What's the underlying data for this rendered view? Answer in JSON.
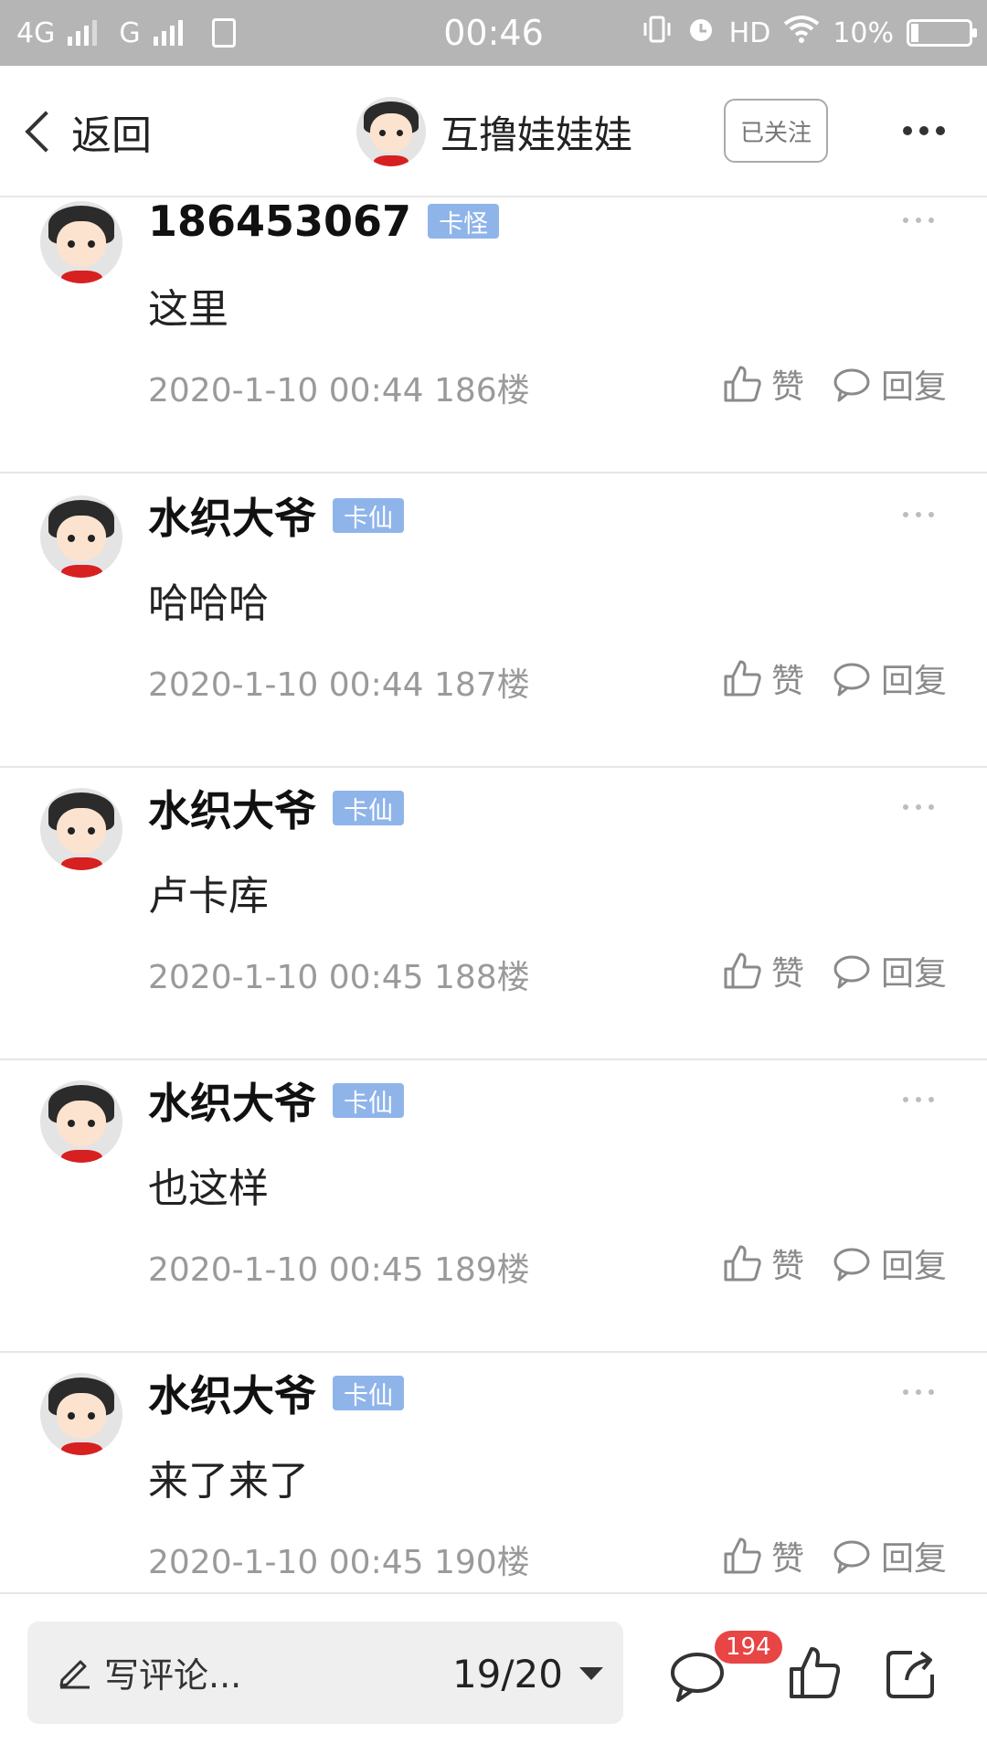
{
  "status_bar": {
    "network1": "4G",
    "network2": "G",
    "time": "00:46",
    "hd": "HD",
    "battery": "10%"
  },
  "nav": {
    "back_label": "返回",
    "user_name": "互撸娃娃娃",
    "follow_label": "已关注"
  },
  "comments": [
    {
      "name": "186453067",
      "badge": "卡怪",
      "text": "这里",
      "meta": "2020-1-10 00:44  186楼",
      "like_label": "赞",
      "reply_label": "回复"
    },
    {
      "name": "水织大爷",
      "badge": "卡仙",
      "text": "哈哈哈",
      "meta": "2020-1-10 00:44  187楼",
      "like_label": "赞",
      "reply_label": "回复"
    },
    {
      "name": "水织大爷",
      "badge": "卡仙",
      "text": "卢卡库",
      "meta": "2020-1-10 00:45  188楼",
      "like_label": "赞",
      "reply_label": "回复"
    },
    {
      "name": "水织大爷",
      "badge": "卡仙",
      "text": "也这样",
      "meta": "2020-1-10 00:45  189楼",
      "like_label": "赞",
      "reply_label": "回复"
    },
    {
      "name": "水织大爷",
      "badge": "卡仙",
      "text": "来了来了",
      "meta": "2020-1-10 00:45  190楼",
      "like_label": "赞",
      "reply_label": "回复"
    }
  ],
  "bottom_bar": {
    "write_placeholder": "写评论...",
    "page_indicator": "19/20",
    "comment_count": "194"
  },
  "colors": {
    "badge": "#8fb4ea",
    "count_badge": "#e84545",
    "status_bar": "#b5b5b5"
  }
}
